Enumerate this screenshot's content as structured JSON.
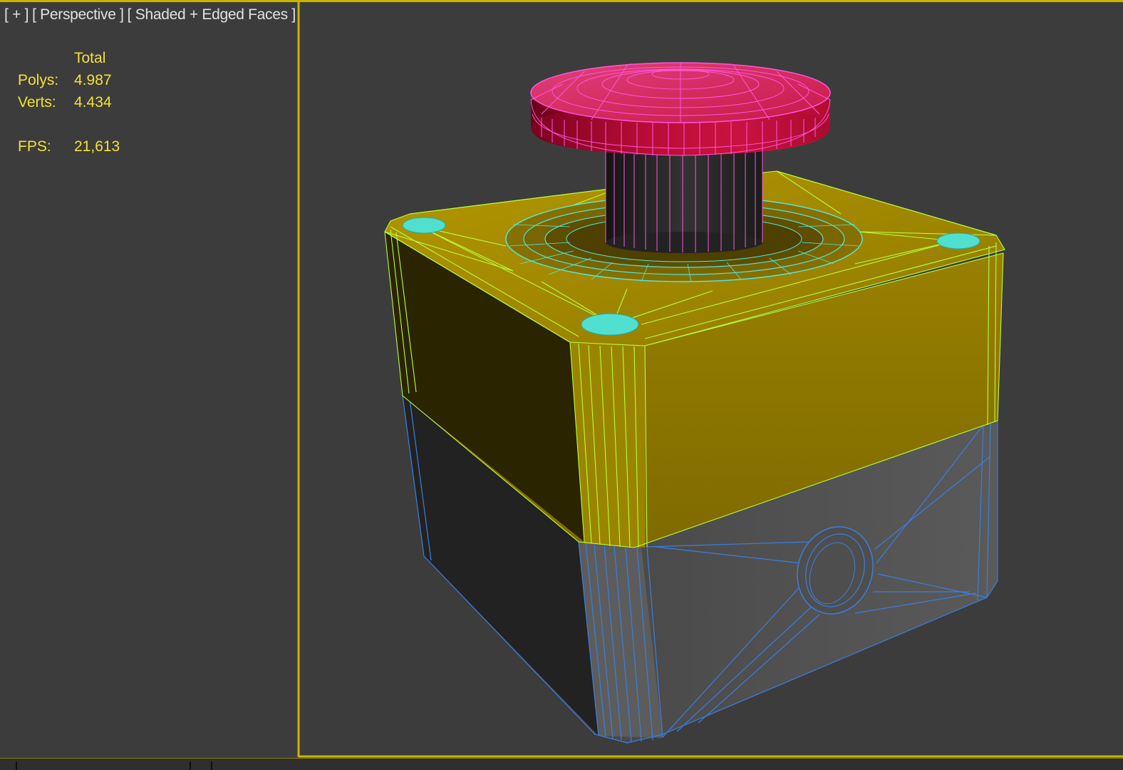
{
  "viewport": {
    "label": {
      "plus": "[ + ]",
      "view": "[ Perspective ]",
      "shading": "[ Shaded + Edged Faces ]"
    },
    "stats": {
      "header": "Total",
      "polys_label": "Polys:",
      "polys_value": "4.987",
      "verts_label": "Verts:",
      "verts_value": "4.434",
      "fps_label": "FPS:",
      "fps_value": "21,613"
    },
    "colors": {
      "background": "#3c3c3c",
      "active_border": "#c9b400",
      "stats_text": "#f3e135",
      "label_text": "#e2e2e2",
      "button_cap": "#d2103c",
      "button_wire": "#ff55dd",
      "lid": "#8a7400",
      "lid_wire": "#b8ff3a",
      "ring_wire": "#55e6d8",
      "base": "#4a4a4a",
      "base_wire": "#3a7fe0"
    }
  }
}
